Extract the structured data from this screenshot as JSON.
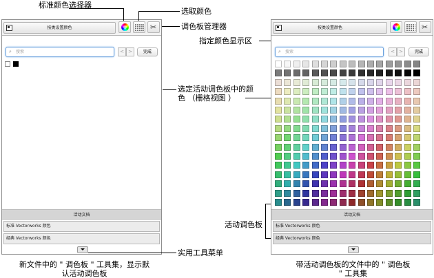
{
  "left_panel": {
    "sort_button": "按类设置颜色",
    "search_placeholder": "搜索",
    "nav_prev": "<",
    "nav_next": ">",
    "done": "完成",
    "active_tab": "活动文档",
    "palette_1": "标准 Vectorworks 颜色",
    "palette_2": "经典 Vectorworks 颜色"
  },
  "right_panel": {
    "sort_button": "按类设置颜色",
    "search_placeholder": "搜索",
    "nav_prev": "<",
    "nav_next": ">",
    "done": "完成",
    "active_tab": "活动文档",
    "palette_1": "标准 Vectorworks 颜色",
    "palette_2": "经典 Vectorworks 颜色"
  },
  "annotations": {
    "standard_color_picker": "标准颜色选择器",
    "pick_color": "选取颜色",
    "palette_manager": "调色板管理器",
    "specified_color_display": "指定颜色显示区",
    "selected_colors_line1": "选定活动调色板中的颜",
    "selected_colors_line2": "色 （栅格视图 ）",
    "active_palette": "活动调色板",
    "utility_menu": "实用工具菜单"
  },
  "captions": {
    "left_line1": "新文件中的 \" 调色板 \" 工具集，显示默",
    "left_line2": "认活动调色板",
    "right_line1": "带活动调色板的文件中的 \" 调色板",
    "right_line2": "\" 工具集"
  }
}
